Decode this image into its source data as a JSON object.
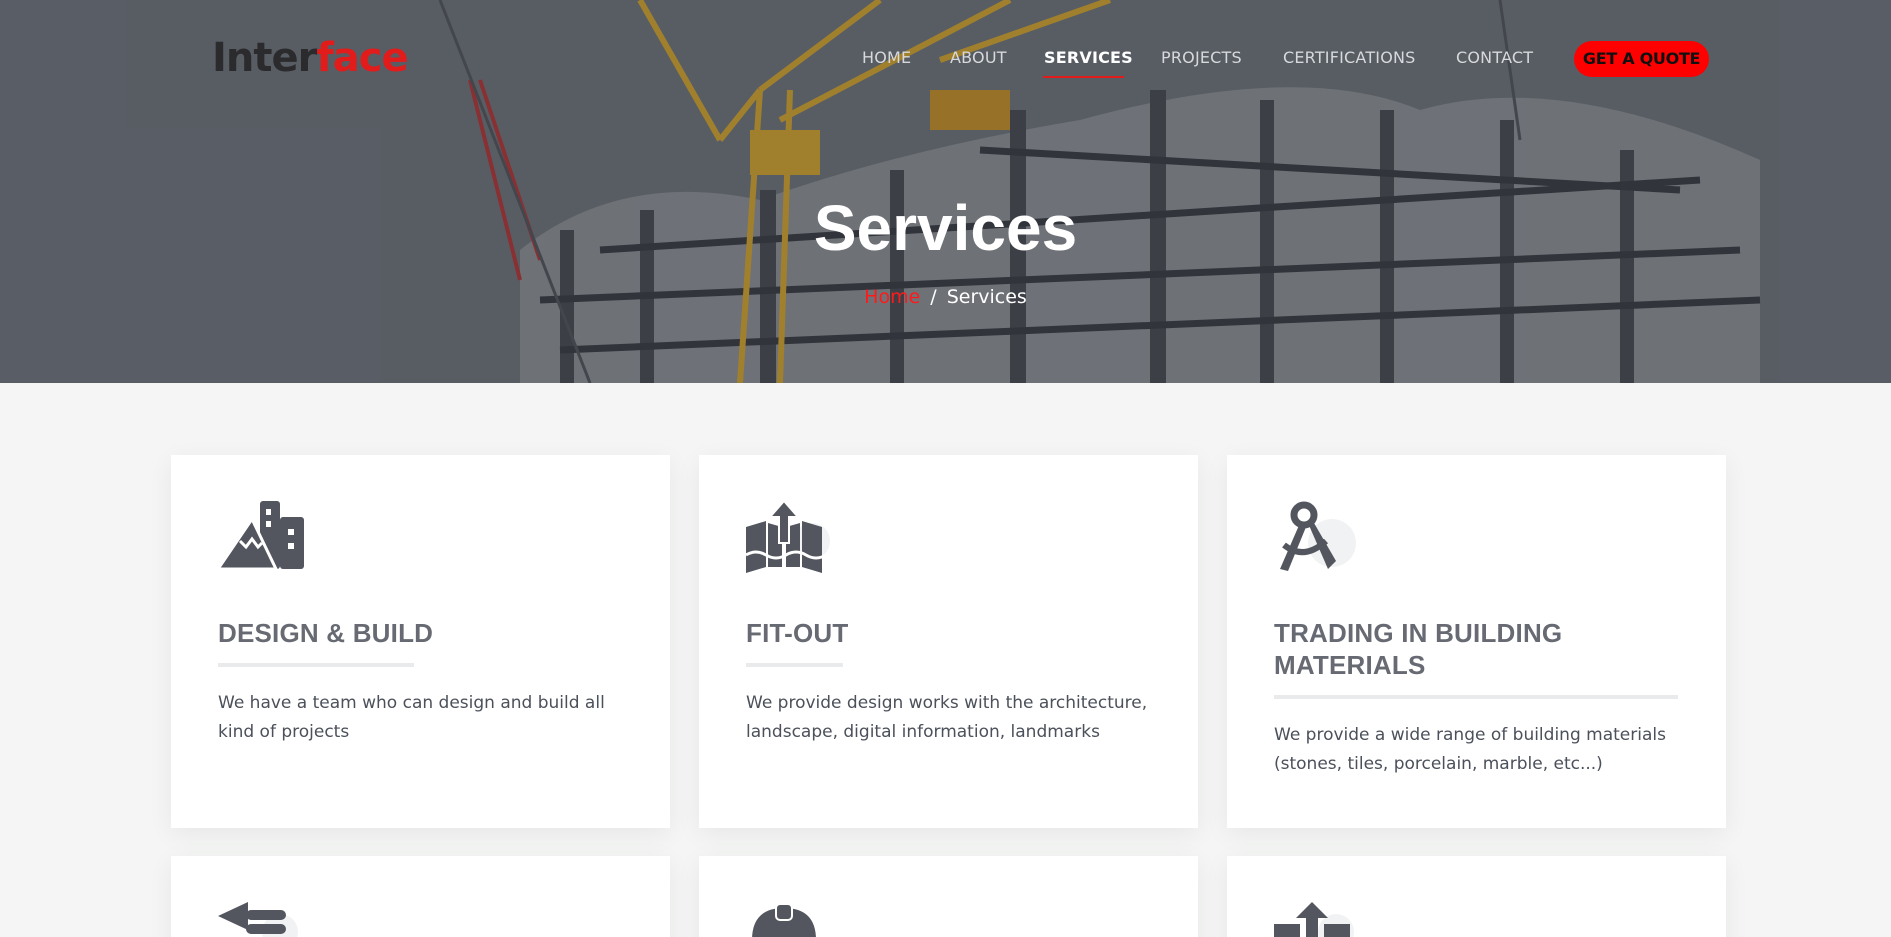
{
  "brand": {
    "logo_part1": "Inter",
    "logo_part2": "face",
    "accent": "#ff0000"
  },
  "nav": {
    "items": [
      {
        "label": "HOME",
        "active": false
      },
      {
        "label": "ABOUT",
        "active": false
      },
      {
        "label": "SERVICES",
        "active": true
      },
      {
        "label": "PROJECTS",
        "active": false
      },
      {
        "label": "CERTIFICATIONS",
        "active": false
      },
      {
        "label": "CONTACT",
        "active": false
      }
    ],
    "cta_label": "GET A QUOTE"
  },
  "hero": {
    "title": "Services",
    "breadcrumb": {
      "home": "Home",
      "separator": "/",
      "current": "Services"
    }
  },
  "services": [
    {
      "icon": "mountain-buildings-icon",
      "title": "DESIGN & BUILD",
      "description": "We have a team who can design and build all kind of projects"
    },
    {
      "icon": "map-upload-icon",
      "title": "FIT-OUT",
      "description": "We provide design works with the architecture, landscape, digital information, landmarks"
    },
    {
      "icon": "drafting-compass-icon",
      "title": "TRADING IN BUILDING MATERIALS",
      "description": "We provide a wide range of building materials (stones, tiles, porcelain, marble, etc...)"
    },
    {
      "icon": "trowel-icon",
      "title": "",
      "description": ""
    },
    {
      "icon": "hard-hat-icon",
      "title": "",
      "description": ""
    },
    {
      "icon": "upload-box-icon",
      "title": "",
      "description": ""
    }
  ]
}
